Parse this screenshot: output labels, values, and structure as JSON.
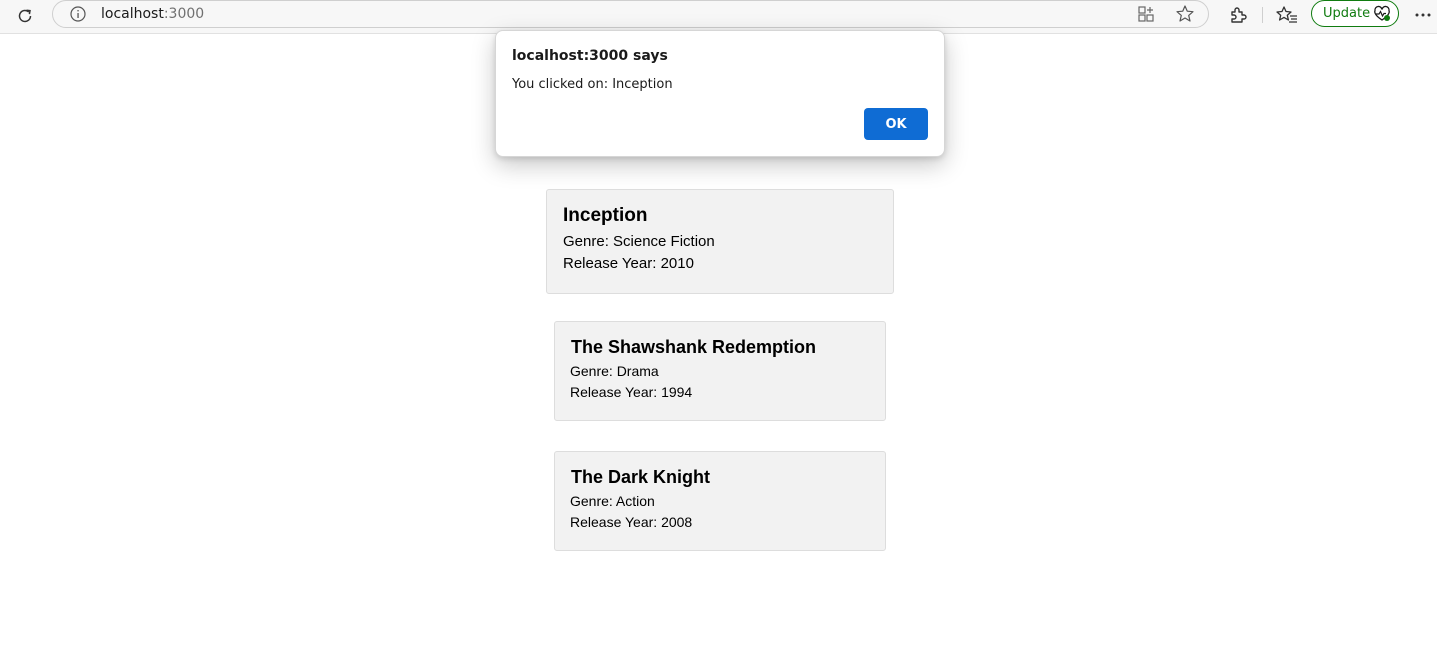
{
  "browser": {
    "address": {
      "host": "localhost",
      "port": ":3000"
    },
    "update_label": "Update",
    "icons": {
      "reload": "reload-icon",
      "info": "info-icon",
      "apps": "app-available-icon",
      "favorite": "star-icon",
      "extensions": "extensions-icon",
      "favorites": "favorites-icon",
      "update": "heart-pulse-icon",
      "more": "more-icon"
    },
    "update_color": "#107c10"
  },
  "dialog": {
    "title": "localhost:3000 says",
    "message": "You clicked on: Inception",
    "ok_label": "OK",
    "ok_color": "#0f6cd4"
  },
  "movies": [
    {
      "title": "Inception",
      "genre": "Genre: Science Fiction",
      "year": "Release Year: 2010"
    },
    {
      "title": "The Shawshank Redemption",
      "genre": "Genre: Drama",
      "year": "Release Year: 1994"
    },
    {
      "title": "The Dark Knight",
      "genre": "Genre: Action",
      "year": "Release Year: 2008"
    }
  ]
}
